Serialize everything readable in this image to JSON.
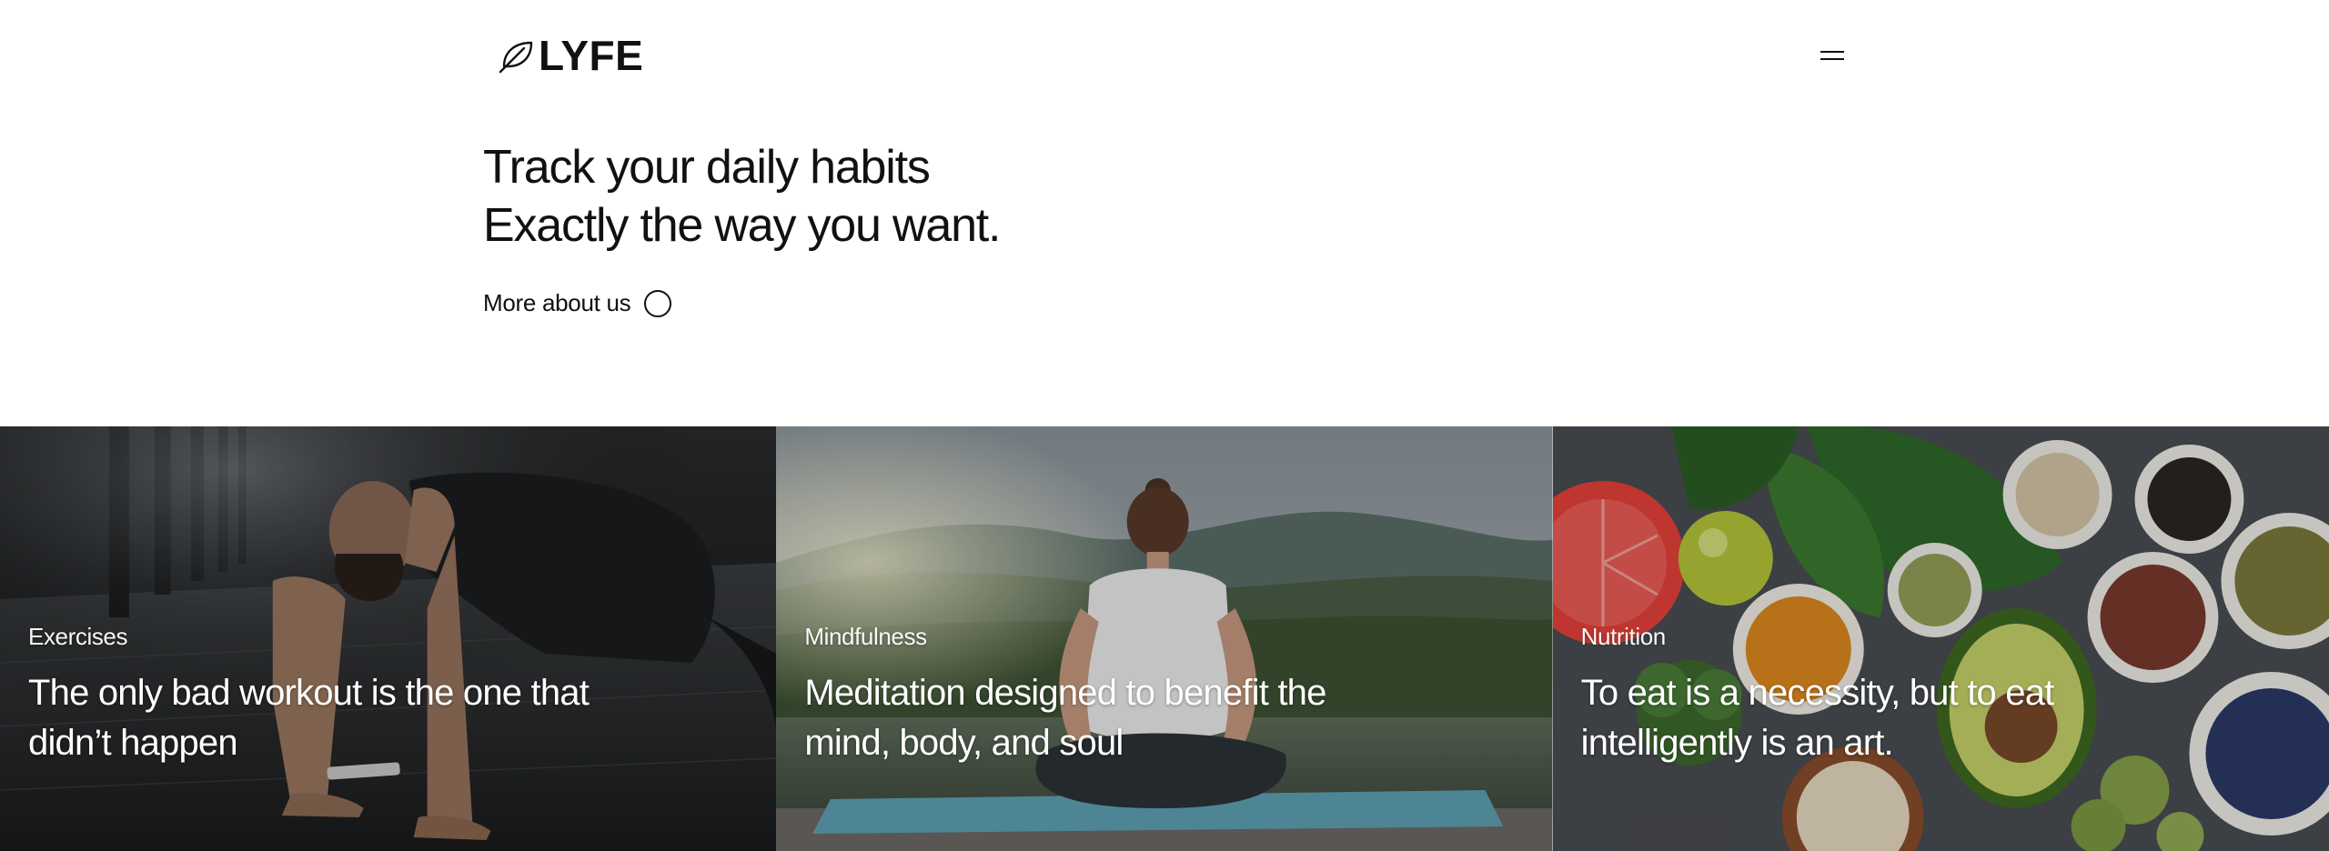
{
  "header": {
    "logo_text": "LYFE",
    "logo_icon": "leaf-icon",
    "menu_icon": "hamburger-menu-icon"
  },
  "hero": {
    "title_line1": "Track your daily habits",
    "title_line2": "Exactly the way you want.",
    "more_link_label": "More about us",
    "more_link_icon": "circle-icon"
  },
  "cards": [
    {
      "category": "Exercises",
      "title": "The only bad workout is the one that didn’t happen",
      "image": "man-doing-push-up-in-gym"
    },
    {
      "category": "Mindfulness",
      "title": "Meditation designed to benefit the mind, body, and soul",
      "image": "woman-meditating-by-lake"
    },
    {
      "category": "Nutrition",
      "title": "To eat is a necessity, but to eat intelligently is an art.",
      "image": "vegetables-and-grains-flatlay"
    }
  ],
  "colors": {
    "text": "#111111",
    "background": "#ffffff",
    "card_text": "#ffffff"
  }
}
